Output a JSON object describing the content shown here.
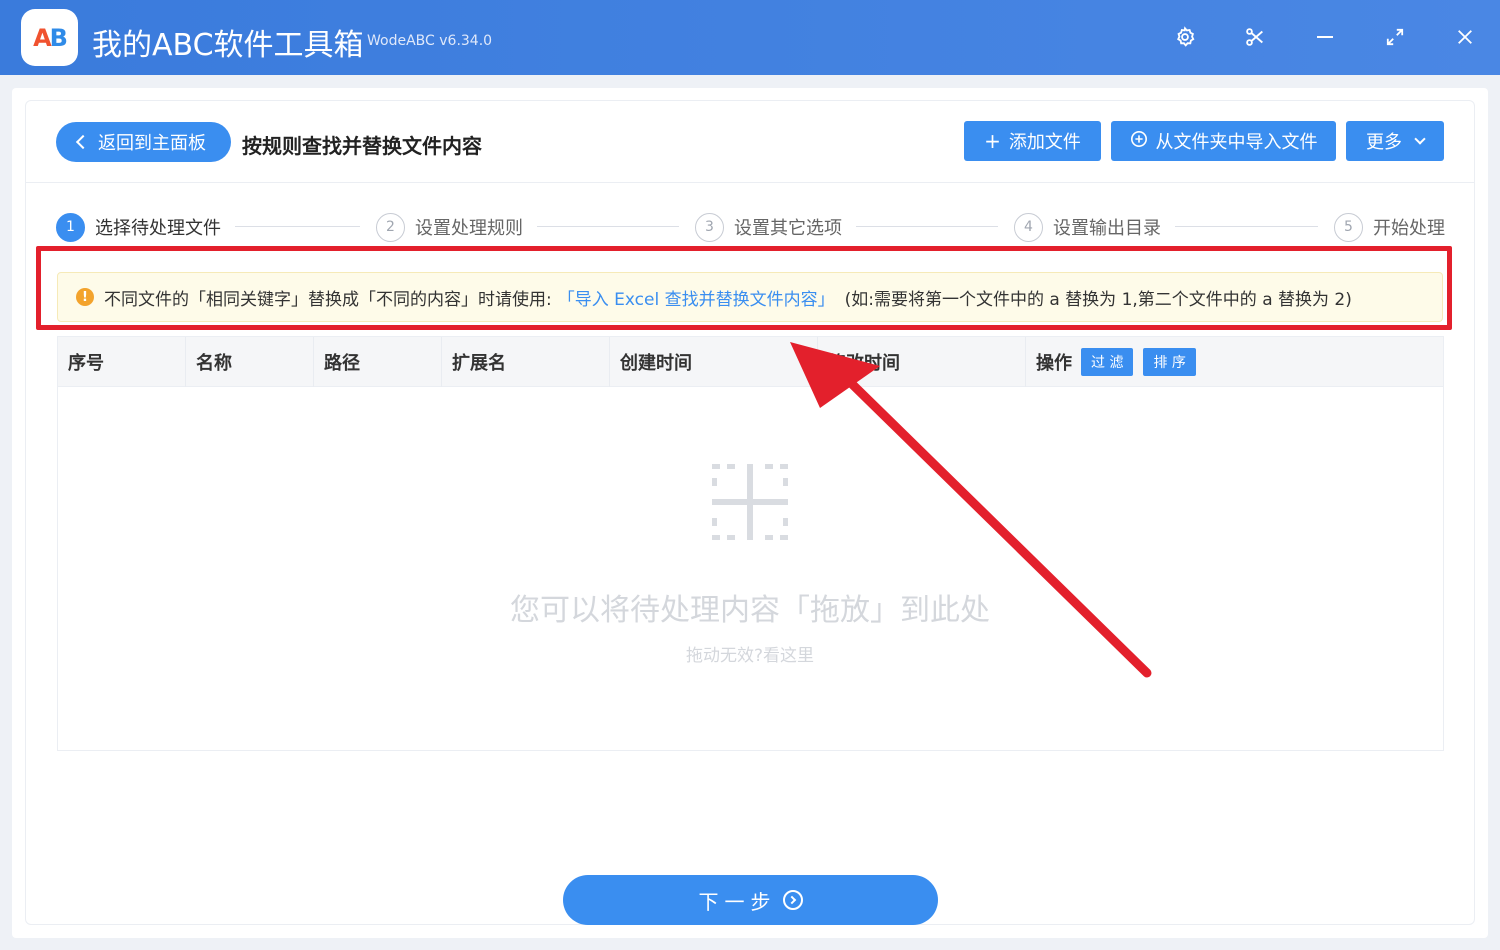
{
  "app": {
    "title": "我的ABC软件工具箱",
    "version": "WodeABC v6.34.0",
    "logo_text_a": "A",
    "logo_text_b": "B"
  },
  "window_controls": [
    "settings-icon",
    "scissors-icon",
    "minimize-icon",
    "maximize-icon",
    "close-icon"
  ],
  "header": {
    "back_label": "返回到主面板",
    "page_title": "按规则查找并替换文件内容",
    "add_file_label": "添加文件",
    "import_folder_label": "从文件夹中导入文件",
    "more_label": "更多"
  },
  "steps": [
    {
      "num": "1",
      "label": "选择待处理文件",
      "active": true
    },
    {
      "num": "2",
      "label": "设置处理规则",
      "active": false
    },
    {
      "num": "3",
      "label": "设置其它选项",
      "active": false
    },
    {
      "num": "4",
      "label": "设置输出目录",
      "active": false
    },
    {
      "num": "5",
      "label": "开始处理",
      "active": false
    }
  ],
  "notice": {
    "text": "不同文件的「相同关键字」替换成「不同的内容」时请使用:",
    "link": "「导入 Excel 查找并替换文件内容」",
    "tail": "(如:需要将第一个文件中的 a 替换为 1,第二个文件中的 a 替换为 2)"
  },
  "table": {
    "columns": [
      "序号",
      "名称",
      "路径",
      "扩展名",
      "创建时间",
      "修改时间",
      "操作"
    ],
    "filter_label": "过 滤",
    "sort_label": "排 序"
  },
  "empty": {
    "title": "您可以将待处理内容「拖放」到此处",
    "help_link": "拖动无效?看这里"
  },
  "footer": {
    "next_label": "下一步"
  },
  "colors": {
    "primary": "#3a8ef0",
    "titlebar": "#3a7bdc",
    "warning": "#f3a32c",
    "annotation_red": "#e3202c"
  }
}
